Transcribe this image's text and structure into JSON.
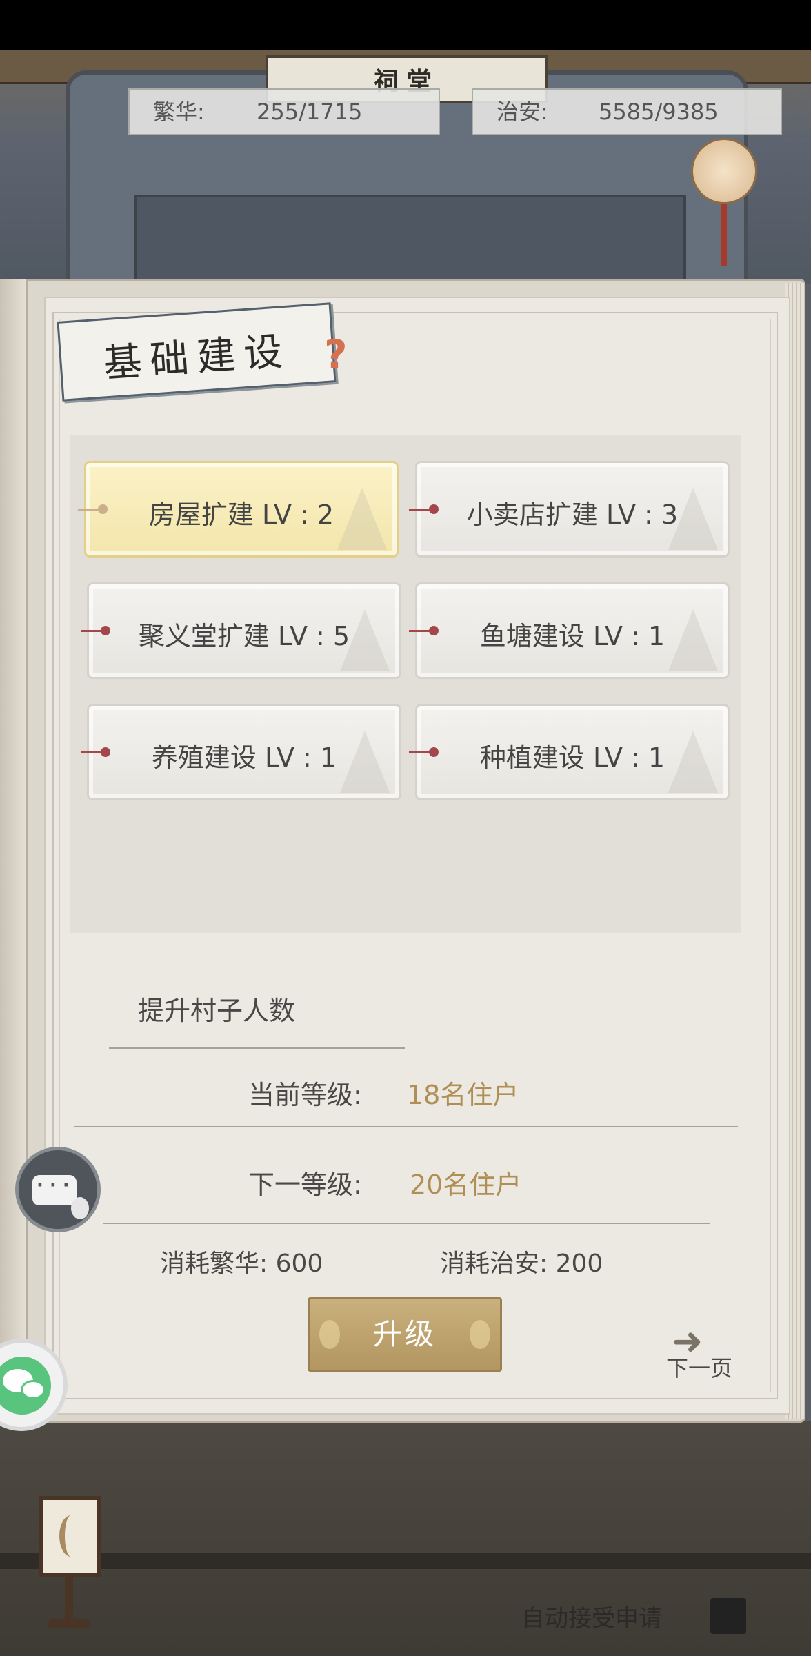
{
  "header": {
    "plaque": "祠堂",
    "prosperity": {
      "label": "繁华:",
      "value": "255/1715"
    },
    "security": {
      "label": "治安:",
      "value": "5585/9385"
    }
  },
  "panel": {
    "title": "基础建设",
    "help_icon": "question-mark",
    "buildings": [
      {
        "label": "房屋扩建 LV : 2",
        "selected": true
      },
      {
        "label": "小卖店扩建 LV : 3",
        "selected": false
      },
      {
        "label": "聚义堂扩建 LV : 5",
        "selected": false
      },
      {
        "label": "鱼塘建设 LV : 1",
        "selected": false
      },
      {
        "label": "养殖建设 LV : 1",
        "selected": false
      },
      {
        "label": "种植建设 LV : 1",
        "selected": false
      }
    ],
    "detail": {
      "description": "提升村子人数",
      "current_level_label": "当前等级:",
      "current_level_value": "18名住户",
      "next_level_label": "下一等级:",
      "next_level_value": "20名住户",
      "cost_prosperity": "消耗繁华:  600",
      "cost_security": "消耗治安:  200"
    },
    "upgrade_label": "升级",
    "next_page_label": "下一页"
  },
  "footer": {
    "auto_accept_label": "自动接受申请",
    "auto_accept_checked": true
  },
  "colors": {
    "accent_gold": "#b08f55",
    "button_gold": "#c9b07c",
    "selected_yellow": "#fbf2c7",
    "pin_red": "#a3474b"
  }
}
